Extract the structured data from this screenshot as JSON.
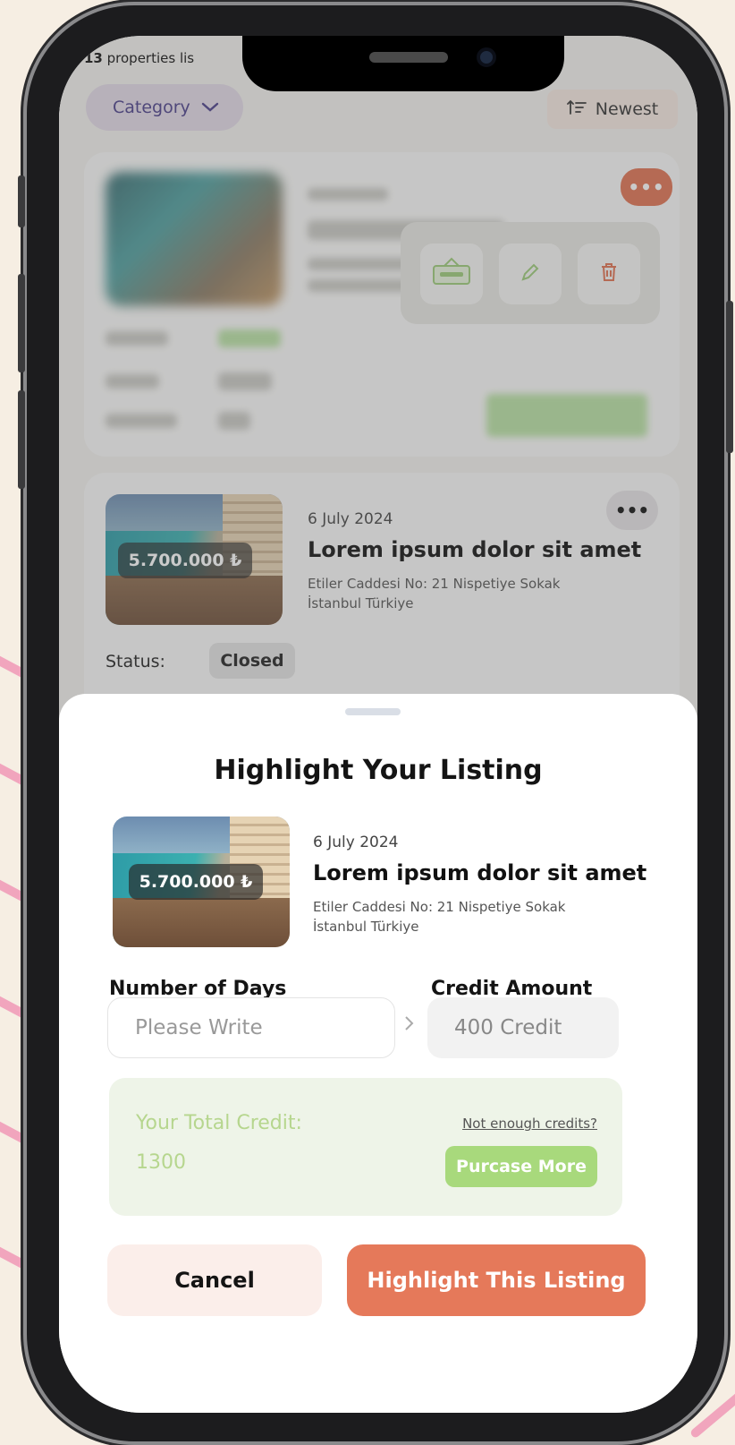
{
  "header": {
    "count_number": "13",
    "count_text": " properties lis",
    "category_label": "Category",
    "sort_label": "Newest"
  },
  "listing": {
    "date": "6 July 2024",
    "title": "Lorem ipsum dolor sit amet",
    "address_line1": "Etiler Caddesi No: 21 Nispetiye Sokak",
    "address_line2": "İstanbul Türkiye",
    "price": "5.700.000 ₺",
    "status_label": "Status:",
    "status_value": "Closed",
    "more_dots": "•••"
  },
  "sheet": {
    "title": "Highlight Your Listing",
    "days_label": "Number of Days",
    "days_placeholder": "Please Write",
    "credit_label": "Credit Amount",
    "credit_value": "400 Credit",
    "total_label": "Your Total Credit:",
    "total_value": "1300",
    "not_enough": "Not enough credits?",
    "purchase_more": "Purcase More",
    "cancel": "Cancel",
    "confirm": "Highlight This Listing"
  },
  "colors": {
    "accent": "#e5795a",
    "credit_green": "#a8d97c",
    "category_pill": "#e3dbe8"
  },
  "icons": [
    "chevron-down-icon",
    "sort-icon",
    "closed-sign-icon",
    "pencil-icon",
    "trash-icon"
  ]
}
